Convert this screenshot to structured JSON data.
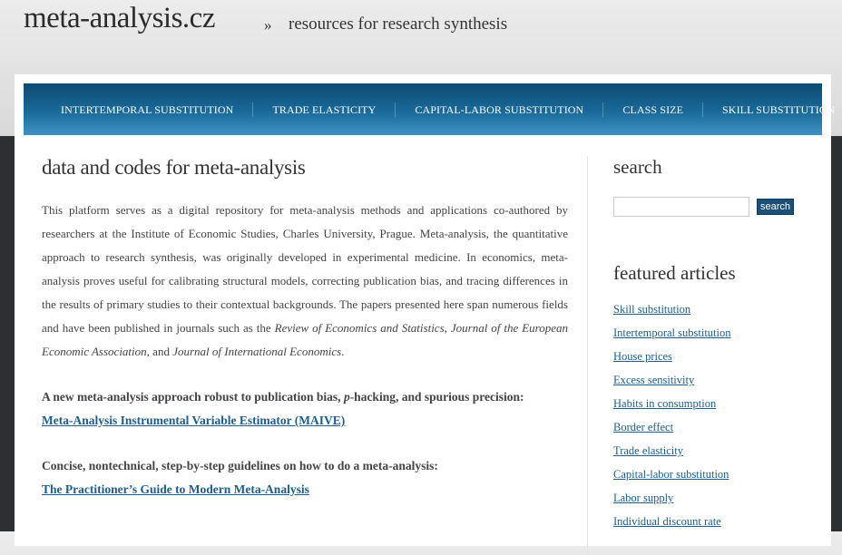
{
  "header": {
    "site_title": "meta-analysis.cz",
    "separator": "»",
    "tagline": "resources for research synthesis"
  },
  "nav": {
    "items": [
      {
        "label": "Intertemporal substitution"
      },
      {
        "label": "Trade elasticity"
      },
      {
        "label": "Capital-labor substitution"
      },
      {
        "label": "Class size"
      },
      {
        "label": "Skill substitution"
      }
    ]
  },
  "main": {
    "title": "data and codes for meta-analysis",
    "intro_part1": "This platform serves as a digital repository for meta-analysis methods and applications co-authored by researchers at the Institute of Economic Studies, Charles University, Prague. Meta-analysis, the quantitative approach to research synthesis, was originally developed in experimental medicine. In economics, meta-analysis proves useful for calibrating structural models, correcting publication bias, and tracing differences in the results of primary studies to their contextual backgrounds. The papers presented here span numerous fields and have been published in journals such as the ",
    "journal1": "Review of Economics and Statistics",
    "sep1": ", ",
    "journal2": "Journal of the European Economic Association",
    "sep2": ", and ",
    "journal3": "Journal of International Economics",
    "end": ".",
    "feature1": {
      "lead_a": "A new meta-analysis approach robust to publication bias, ",
      "lead_p": "p",
      "lead_b": "-hacking, and spurious precision:",
      "link": "Meta-Analysis Instrumental Variable Estimator (MAIVE)"
    },
    "feature2": {
      "lead": "Concise, nontechnical, step-by-step guidelines on how to do a meta-analysis:",
      "link": "The Practitioner’s Guide to Modern Meta-Analysis"
    }
  },
  "sidebar": {
    "search_heading": "search",
    "search_value": "",
    "search_button": "search",
    "featured_heading": "featured articles",
    "articles": [
      {
        "label": "Skill substitution"
      },
      {
        "label": "Intertemporal substitution"
      },
      {
        "label": "House prices"
      },
      {
        "label": "Excess sensitivity"
      },
      {
        "label": "Habits in consumption"
      },
      {
        "label": "Border effect"
      },
      {
        "label": "Trade elasticity"
      },
      {
        "label": "Capital-labor substitution"
      },
      {
        "label": "Labor supply"
      },
      {
        "label": "Individual discount rate"
      }
    ]
  }
}
